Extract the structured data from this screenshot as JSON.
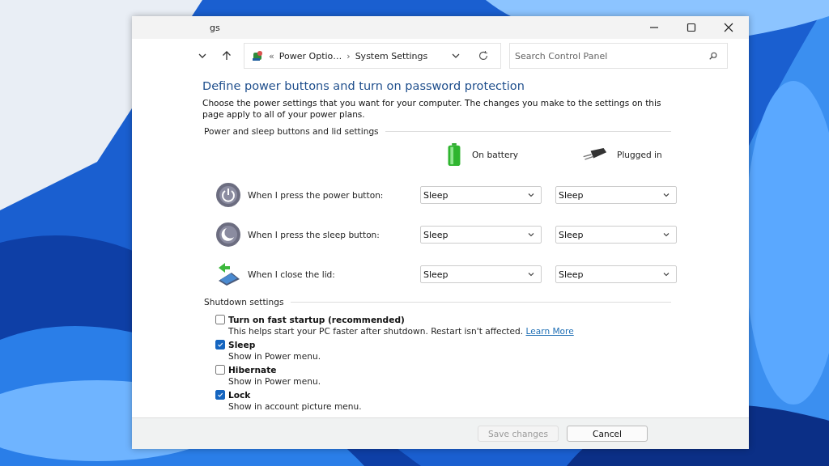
{
  "window": {
    "title": "gs"
  },
  "nav": {
    "prefix": "«",
    "separator": "›",
    "crumbs": [
      "Power Optio…",
      "System Settings"
    ],
    "search": {
      "placeholder": "Search Control Panel"
    }
  },
  "heading": "Define power buttons and turn on password protection",
  "intro": "Choose the power settings that you want for your computer. The changes you make to the settings on this page apply to all of your power plans.",
  "buttons_section": {
    "title": "Power and sleep buttons and lid settings",
    "columns": [
      {
        "kind": "battery",
        "label": "On battery"
      },
      {
        "kind": "plug",
        "label": "Plugged in"
      }
    ],
    "rows": [
      {
        "kind": "power",
        "label": "When I press the power button:",
        "values": [
          "Sleep",
          "Sleep"
        ]
      },
      {
        "kind": "sleep",
        "label": "When I press the sleep button:",
        "values": [
          "Sleep",
          "Sleep"
        ]
      },
      {
        "kind": "lid",
        "label": "When I close the lid:",
        "values": [
          "Sleep",
          "Sleep"
        ]
      }
    ]
  },
  "shutdown_section": {
    "title": "Shutdown settings",
    "options": [
      {
        "label": "Turn on fast startup (recommended)",
        "checked": false,
        "description": "This helps start your PC faster after shutdown. Restart isn't affected.",
        "link": "Learn More"
      },
      {
        "label": "Sleep",
        "checked": true,
        "description": "Show in Power menu."
      },
      {
        "label": "Hibernate",
        "checked": false,
        "description": "Show in Power menu."
      },
      {
        "label": "Lock",
        "checked": true,
        "description": "Show in account picture menu."
      }
    ]
  },
  "footer_buttons": [
    {
      "label": "Save changes",
      "disabled": true
    },
    {
      "label": "Cancel",
      "disabled": false
    }
  ]
}
